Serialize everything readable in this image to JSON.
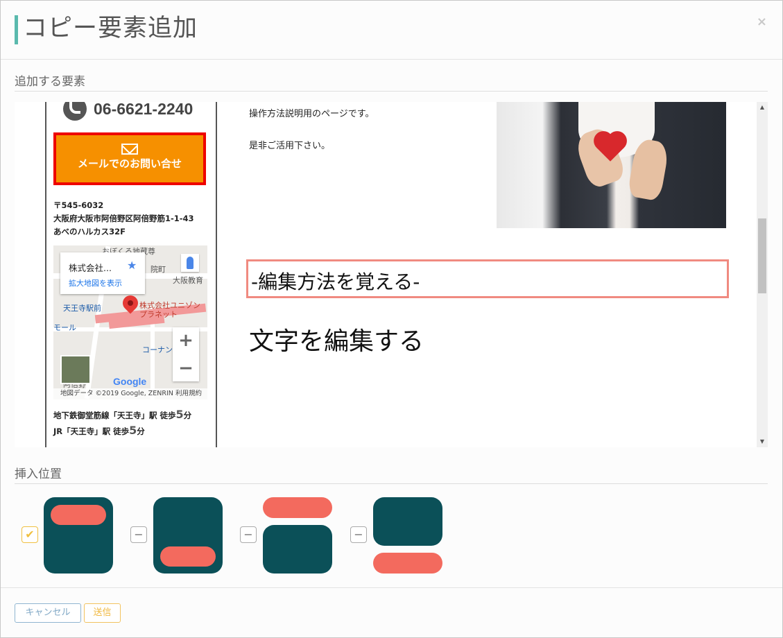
{
  "dialog": {
    "title": "コピー要素追加",
    "close_label": "×"
  },
  "sections": {
    "elements_label": "追加する要素",
    "position_label": "挿入位置"
  },
  "preview": {
    "phone": "06-6621-2240",
    "mail_button": "メールでのお問い合せ",
    "address": [
      "〒545-6032",
      "大阪府大阪市阿倍野区阿倍野筋1-1-43",
      "あべのハルカス32F"
    ],
    "map": {
      "place_name": "株式会社...",
      "enlarge_link": "拡大地図を表示",
      "labels": [
        "おぼくろ地蔵尊",
        "院町",
        "大阪教育",
        "天王寺駅前",
        "株式会社ユニゾン",
        "プラネット",
        "モール",
        "コーナン",
        "阿倍野"
      ],
      "footer_left": "地図データ ©2019 Google, ZENRIN",
      "footer_right": "利用規約",
      "google_logo": "Google",
      "zoom_in": "+",
      "zoom_out": "−"
    },
    "access": [
      {
        "prefix": "地下鉄御堂筋線「天王寺」駅 徒歩",
        "num": "5",
        "suffix": "分"
      },
      {
        "prefix": "JR「天王寺」駅 徒歩",
        "num": "5",
        "suffix": "分"
      }
    ],
    "intro_line1": "操作方法説明用のページです。",
    "intro_line2": "是非ご活用下さい。",
    "heading_selected": "-編集方法を覚える-",
    "heading_2": "文字を編集する"
  },
  "positions": [
    {
      "name": "inside-top",
      "checked": true
    },
    {
      "name": "inside-bottom",
      "checked": false
    },
    {
      "name": "before",
      "checked": false
    },
    {
      "name": "after",
      "checked": false
    }
  ],
  "buttons": {
    "cancel": "キャンセル",
    "send": "送信"
  },
  "colors": {
    "accent": "#5ab9ad",
    "teal": "#0b5058",
    "coral": "#f36a5e",
    "mail_orange": "#f69000"
  }
}
